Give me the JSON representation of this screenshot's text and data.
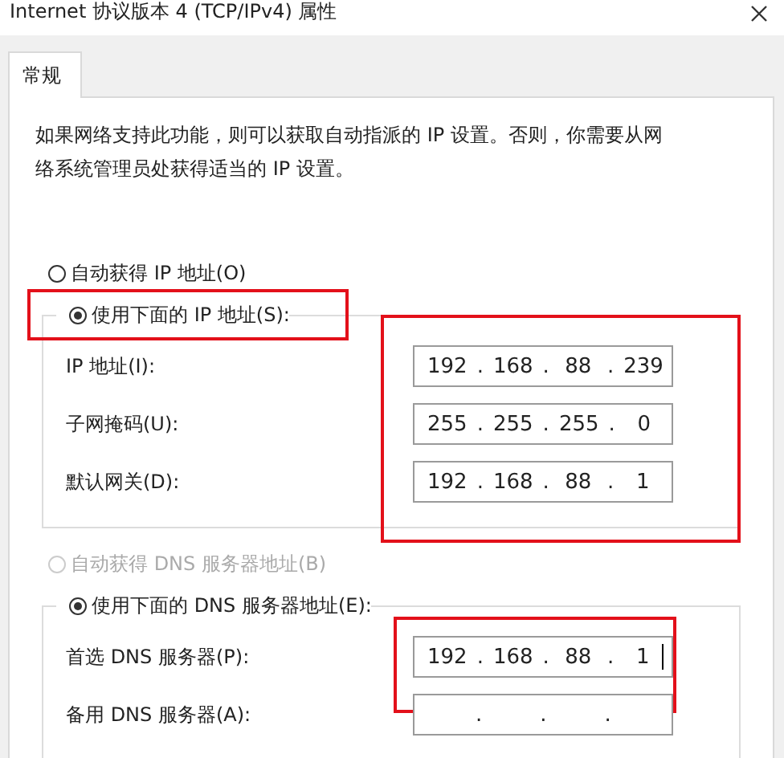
{
  "window": {
    "title": "Internet 协议版本 4 (TCP/IPv4) 属性"
  },
  "tabs": [
    {
      "label": "常规",
      "selected": true
    }
  ],
  "description": "如果网络支持此功能，则可以获取自动指派的 IP 设置。否则，你需要从网络系统管理员处获得适当的 IP 设置。",
  "separator": ".",
  "sections": [
    {
      "options": [
        {
          "label": "自动获得 IP 地址(O)",
          "selected": false,
          "disabled": false,
          "highlighted": false
        },
        {
          "label": "使用下面的 IP 地址(S):",
          "selected": true,
          "disabled": false,
          "highlighted": true
        }
      ],
      "fields_highlighted": true,
      "fields": [
        {
          "label": "IP 地址(I):",
          "octets": [
            "192",
            "168",
            "88",
            "239"
          ],
          "focused": false
        },
        {
          "label": "子网掩码(U):",
          "octets": [
            "255",
            "255",
            "255",
            "0"
          ],
          "focused": false
        },
        {
          "label": "默认网关(D):",
          "octets": [
            "192",
            "168",
            "88",
            "1"
          ],
          "focused": false
        }
      ]
    },
    {
      "options": [
        {
          "label": "自动获得 DNS 服务器地址(B)",
          "selected": false,
          "disabled": true,
          "highlighted": false
        },
        {
          "label": "使用下面的 DNS 服务器地址(E):",
          "selected": true,
          "disabled": false,
          "highlighted": false
        }
      ],
      "fields_highlighted": false,
      "fields": [
        {
          "label": "首选 DNS 服务器(P):",
          "octets": [
            "192",
            "168",
            "88",
            "1"
          ],
          "focused": true,
          "highlighted": true
        },
        {
          "label": "备用 DNS 服务器(A):",
          "focused": false,
          "highlighted": false
        }
      ]
    }
  ]
}
